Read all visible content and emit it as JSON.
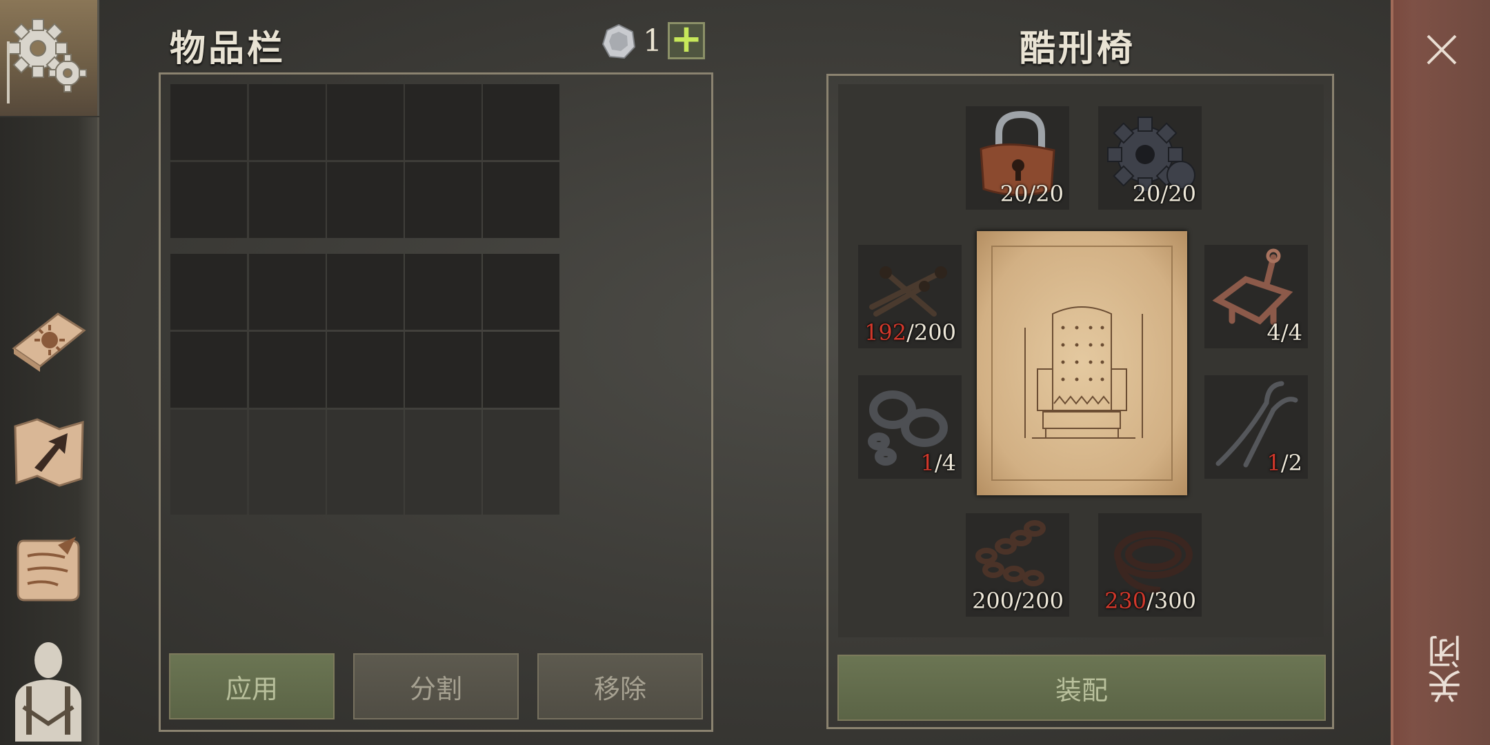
{
  "inventory": {
    "title": "物品栏",
    "currency_value": "1",
    "currency_add_label": "+",
    "buttons": {
      "apply": "应用",
      "split": "分割",
      "remove": "移除"
    }
  },
  "device": {
    "title": "酷刑椅",
    "equip_label": "装配",
    "slots": [
      {
        "item": "padlock-icon",
        "current": "20",
        "max": "20",
        "low": false
      },
      {
        "item": "gear-icon",
        "current": "20",
        "max": "20",
        "low": false
      },
      {
        "item": "nails-icon",
        "current": "192",
        "max": "200",
        "low": true
      },
      {
        "item": "clamp-icon",
        "current": "4",
        "max": "4",
        "low": false
      },
      {
        "item": "shackles-icon",
        "current": "1",
        "max": "4",
        "low": true
      },
      {
        "item": "pincers-icon",
        "current": "1",
        "max": "2",
        "low": true
      },
      {
        "item": "chain-icon",
        "current": "200",
        "max": "200",
        "low": false
      },
      {
        "item": "leather-icon",
        "current": "230",
        "max": "300",
        "low": true
      }
    ]
  },
  "close_label": "关闭",
  "colors": {
    "low_count": "#d2382b",
    "green_button": "#5f6949",
    "close_strip": "#7a4a3f"
  }
}
